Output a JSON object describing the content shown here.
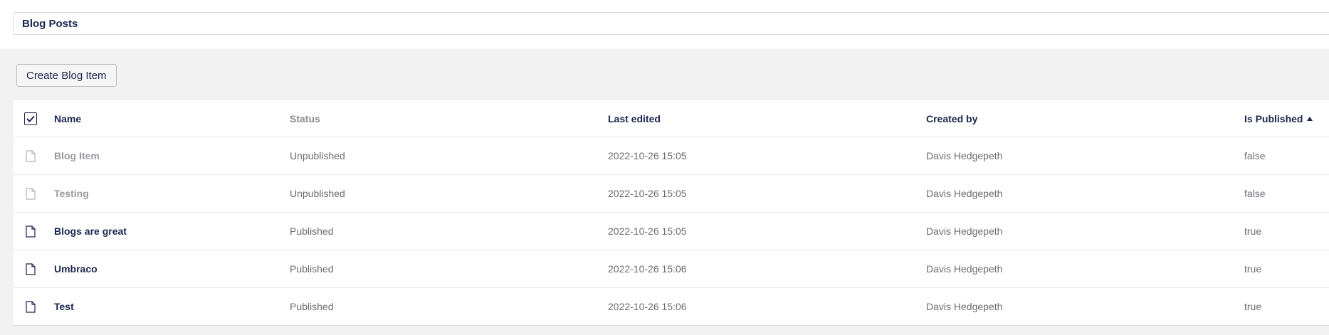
{
  "header": {
    "title": "Blog Posts"
  },
  "toolbar": {
    "create_label": "Create Blog Item"
  },
  "table": {
    "columns": {
      "name": "Name",
      "status": "Status",
      "last_edited": "Last edited",
      "created_by": "Created by",
      "is_published": "Is Published"
    },
    "sort": {
      "column": "is_published",
      "direction": "ascending"
    },
    "rows": [
      {
        "name": "Blog Item",
        "status": "Unpublished",
        "last_edited": "2022-10-26 15:05",
        "created_by": "Davis Hedgepeth",
        "is_published": "false",
        "icon": "document-icon"
      },
      {
        "name": "Testing",
        "status": "Unpublished",
        "last_edited": "2022-10-26 15:05",
        "created_by": "Davis Hedgepeth",
        "is_published": "false",
        "icon": "document-icon"
      },
      {
        "name": "Blogs are great",
        "status": "Published",
        "last_edited": "2022-10-26 15:05",
        "created_by": "Davis Hedgepeth",
        "is_published": "true",
        "icon": "document-icon"
      },
      {
        "name": "Umbraco",
        "status": "Published",
        "last_edited": "2022-10-26 15:06",
        "created_by": "Davis Hedgepeth",
        "is_published": "true",
        "icon": "document-icon"
      },
      {
        "name": "Test",
        "status": "Published",
        "last_edited": "2022-10-26 15:06",
        "created_by": "Davis Hedgepeth",
        "is_published": "true",
        "icon": "document-icon"
      }
    ]
  },
  "colors": {
    "text_primary": "#1b264f",
    "text_muted": "#6c6c74",
    "background_panel": "#f3f2f3"
  }
}
